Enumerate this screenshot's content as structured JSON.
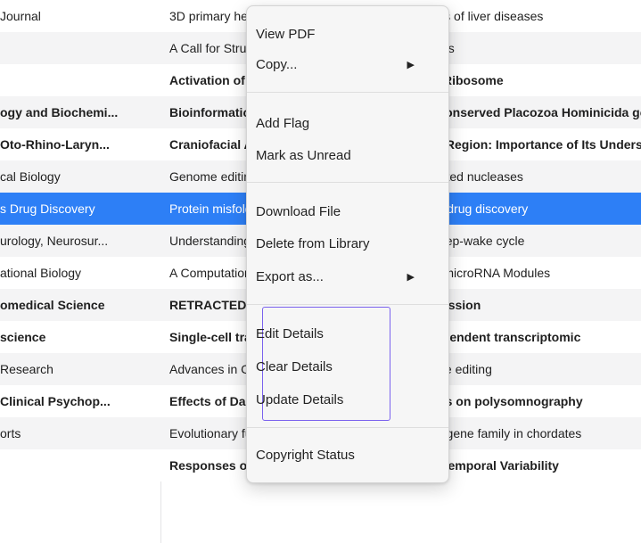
{
  "rows": [
    {
      "journal": "Journal",
      "title": "3D primary hepatocyte culture models for analyses of liver diseases",
      "bold": false
    },
    {
      "journal": "",
      "title": "A Call for Structural Classification of Solute Carriers",
      "bold": false
    },
    {
      "journal": "",
      "title": "Activation of Translation Termination with the Ribosome",
      "bold": true
    },
    {
      "journal": "ogy and Biochemi...",
      "title": "Bioinformatic Analysis of the Vertebrate Ultraconserved Placozoa Hominicida genes in vertebrates",
      "bold": true
    },
    {
      "journal": "Oto-Rhino-Laryn...",
      "title": "Craniofacial Anatomy of the Middle Ear Cavity Region: Importance of Its Understanding",
      "bold": true
    },
    {
      "journal": "cal Biology",
      "title": "Genome editing with engineered CRISPR-associated nucleases",
      "bold": false
    },
    {
      "journal": "s Drug Discovery",
      "title": "Protein misfolding as an emerging target class for drug discovery",
      "bold": false
    },
    {
      "journal": "urology, Neurosur...",
      "title": "Understanding the role of the brain stem in the sleep-wake cycle",
      "bold": false
    },
    {
      "journal": "ational Biology",
      "title": "A Computational Framework for Identifying Gene-microRNA Modules",
      "bold": false
    },
    {
      "journal": "omedical Science",
      "title": "RETRACTED: Molecular Mechanisms in progression",
      "bold": true
    },
    {
      "journal": "science",
      "title": "Single-cell transcriptomics reveals context-dependent transcriptomic",
      "bold": true
    },
    {
      "journal": "Research",
      "title": "Advances in CRISPR-Cas9 technology for genome editing",
      "bold": false
    },
    {
      "journal": "Clinical Psychop...",
      "title": "Effects of Daridorexant on the Locus Coeruleus on polysomnography",
      "bold": true
    },
    {
      "journal": "orts",
      "title": "Evolutionary functional elaboration of the Elovl2/5 gene family in chordates",
      "bold": false
    },
    {
      "journal": "",
      "title": "Responses of Corn Grain Yield to Spatial and Temporal Variability",
      "bold": true
    }
  ],
  "selected_row_index": 6,
  "menu": {
    "view_pdf": "View PDF",
    "copy": "Copy...",
    "add_flag": "Add Flag",
    "mark_unread": "Mark as Unread",
    "download_file": "Download File",
    "delete_from_library": "Delete from Library",
    "export_as": "Export as...",
    "edit_details": "Edit Details",
    "clear_details": "Clear Details",
    "update_details": "Update Details",
    "copyright_status": "Copyright Status",
    "submenu_arrow": "▶"
  },
  "colors": {
    "selection": "#2d7ff6",
    "highlight_box": "#7a62ee"
  }
}
